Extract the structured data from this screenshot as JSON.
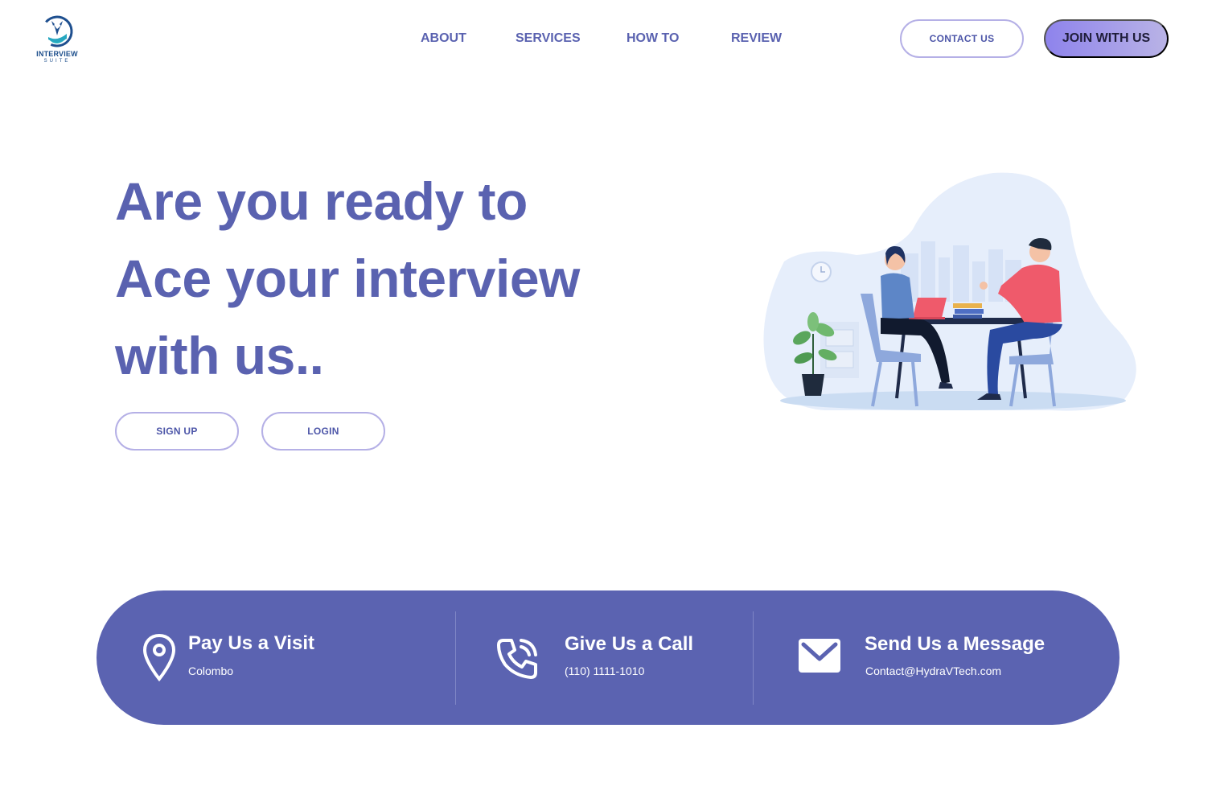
{
  "brand": {
    "name": "INTERVIEW",
    "tagline": "SUITE",
    "logo_icon": "whale-tail-logo-icon"
  },
  "nav": {
    "items": [
      {
        "label": "ABOUT"
      },
      {
        "label": "SERVICES"
      },
      {
        "label": "HOW TO"
      },
      {
        "label": "REVIEW"
      }
    ],
    "contact_label": "CONTACT US",
    "join_label": "JOIN WITH US"
  },
  "hero": {
    "lines": [
      "Are you ready to",
      "Ace your interview",
      "with us.."
    ],
    "signup_label": "SIGN UP",
    "login_label": "LOGIN",
    "illustration": "job-interview-illustration"
  },
  "contact": {
    "visit": {
      "title": "Pay Us a Visit",
      "detail": "Colombo",
      "icon": "location-pin-icon"
    },
    "call": {
      "title": "Give Us a Call",
      "detail": "(110) 1111-1010",
      "icon": "phone-call-icon"
    },
    "message": {
      "title": "Send Us a Message",
      "detail": "Contact@HydraVTech.com",
      "icon": "envelope-icon"
    }
  },
  "colors": {
    "primary": "#5a62b0",
    "band": "#5b63b1",
    "accent_light": "#b5b0e6",
    "join_gradient_start": "#8e83ec",
    "join_gradient_end": "#b9b3e6"
  }
}
